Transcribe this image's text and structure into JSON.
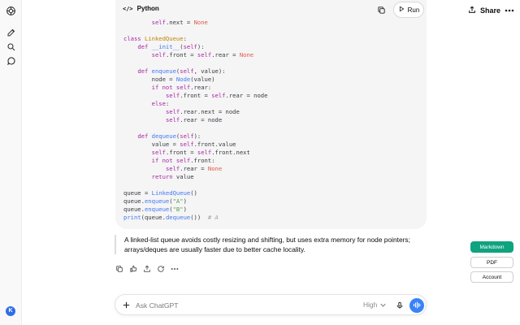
{
  "code_block": {
    "language": "Python",
    "language_icon": "code-brackets-icon",
    "run_label": "Run"
  },
  "header": {
    "share_label": "Share"
  },
  "response": {
    "text": "A linked-list queue avoids costly resizing and shifting, but uses extra memory for node pointers; arrays/deques are usually faster due to better cache locality."
  },
  "side_buttons": {
    "markdown": "Markdown",
    "pdf": "PDF",
    "account": "Account"
  },
  "composer": {
    "placeholder": "Ask ChatGPT",
    "effort": "High"
  },
  "avatar": {
    "initial": "K"
  },
  "colors": {
    "accent_green": "#10a37f",
    "voice_blue": "#3a82f7",
    "code_bg": "#f5f5f5"
  }
}
